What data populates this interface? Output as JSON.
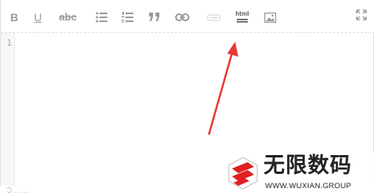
{
  "toolbar": {
    "bold_label": "B",
    "underline_label": "U",
    "strikethrough_label": "abc",
    "html_label": "html"
  },
  "editor": {
    "line_numbers": [
      "1"
    ],
    "content": ""
  },
  "footer": {
    "text": "Ɔ  ... ..."
  },
  "watermark": {
    "title": "无限数码",
    "subtitle": "WWW.WUXIAN.GROUP"
  },
  "colors": {
    "icon": "#9a9a9a",
    "arrow": "#e53935",
    "gutter_bg": "#f7f7f7",
    "logo_red": "#e02020"
  },
  "icons": [
    "bold-icon",
    "underline-icon",
    "strikethrough-icon",
    "bullet-list-icon",
    "numbered-list-icon",
    "quote-icon",
    "link-icon",
    "horizontal-rule-icon",
    "html-icon",
    "image-icon",
    "fullscreen-icon",
    "wuxian-logo-icon"
  ]
}
